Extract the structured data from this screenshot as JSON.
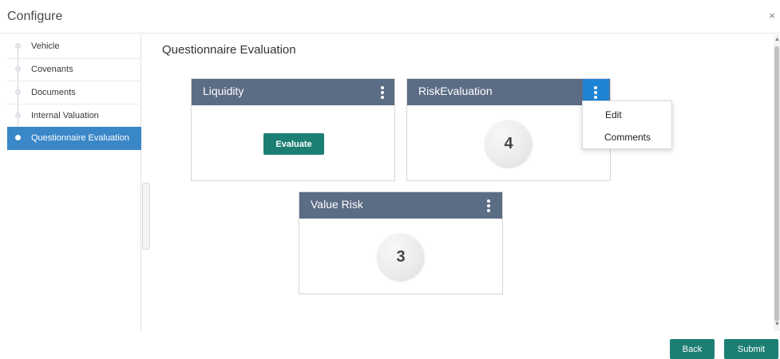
{
  "header": {
    "title": "Configure",
    "close_icon": "×"
  },
  "sidebar": {
    "items": [
      {
        "label": "Vehicle",
        "active": false
      },
      {
        "label": "Covenants",
        "active": false
      },
      {
        "label": "Documents",
        "active": false
      },
      {
        "label": "Internal Valuation",
        "active": false
      },
      {
        "label": "Questionnaire Evaluation",
        "active": true
      }
    ]
  },
  "main": {
    "title": "Questionnaire Evaluation",
    "cards": [
      {
        "title": "Liquidity",
        "action_label": "Evaluate"
      },
      {
        "title": "RiskEvaluation",
        "score": "4"
      },
      {
        "title": "Value Risk",
        "score": "3"
      }
    ],
    "menu": {
      "items": [
        {
          "label": "Edit"
        },
        {
          "label": "Comments"
        }
      ]
    }
  },
  "footer": {
    "back_label": "Back",
    "submit_label": "Submit"
  },
  "colors": {
    "card_header": "#5b6c85",
    "active_nav": "#3a87c8",
    "primary_button": "#1d7f74",
    "menu_trigger_active": "#1f84d6"
  },
  "icons": {
    "close": "close-icon",
    "card_menu": "kebab-menu-icon",
    "nav_step": "step-dot-icon"
  }
}
